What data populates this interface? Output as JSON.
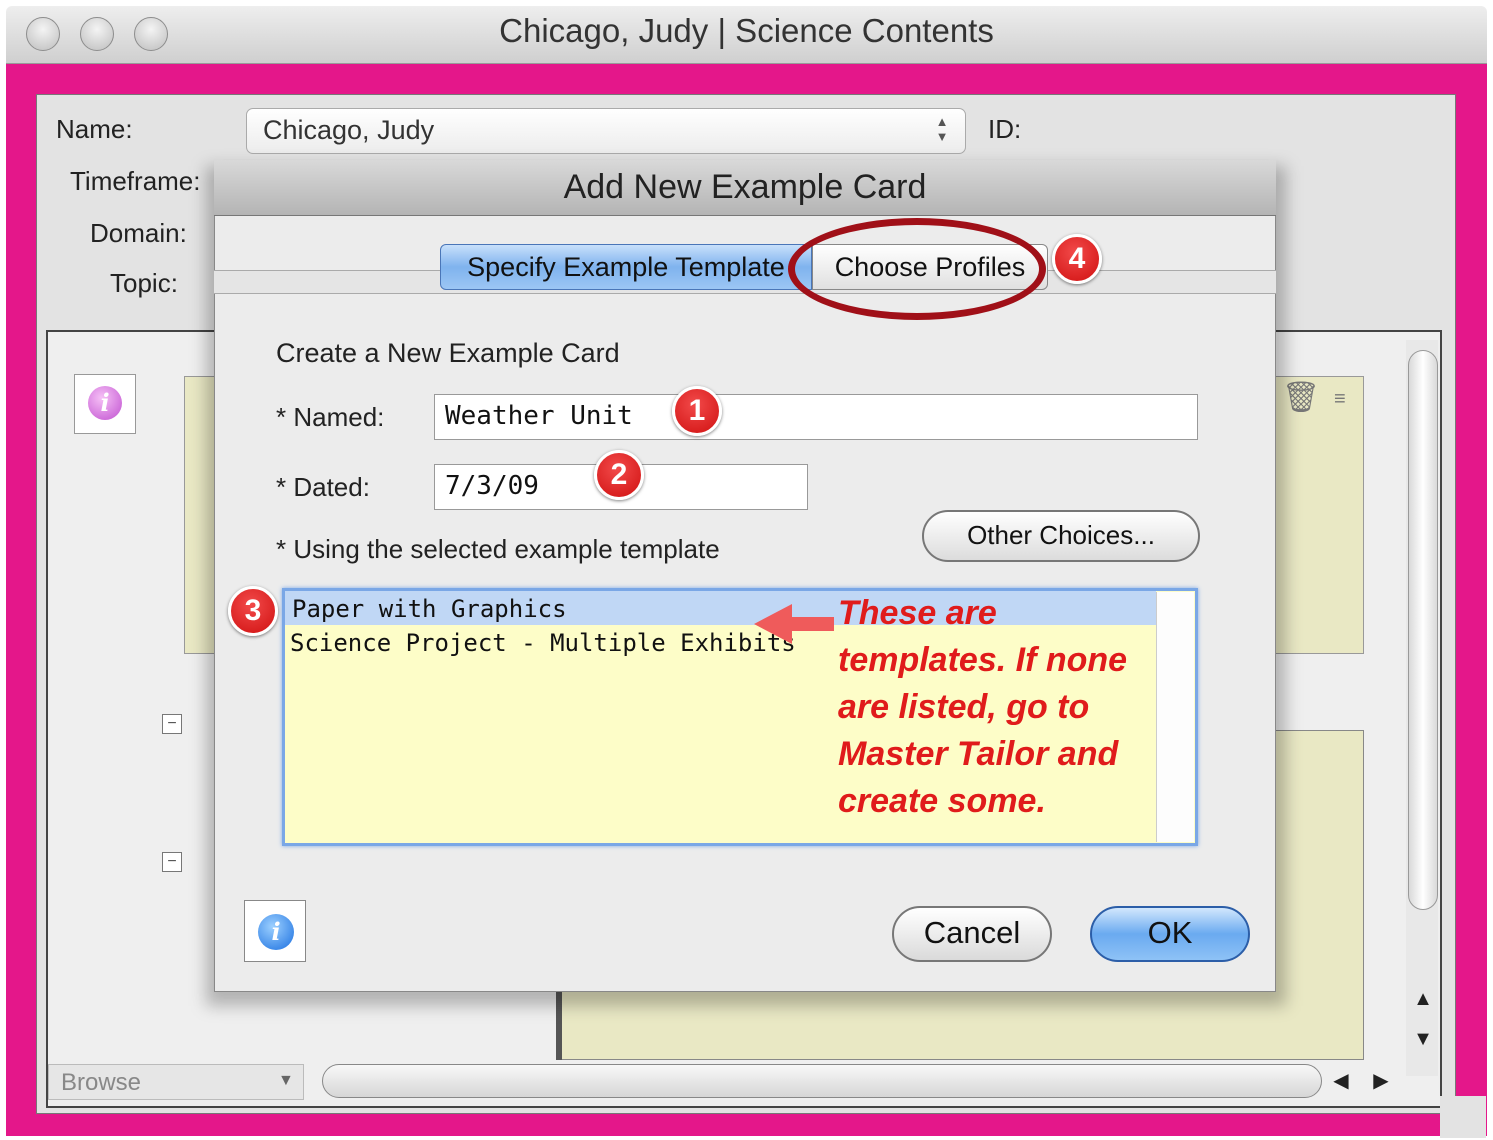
{
  "window": {
    "title": "Chicago, Judy | Science Contents"
  },
  "form": {
    "name_label": "Name:",
    "name_value": "Chicago, Judy",
    "id_label": "ID:",
    "timeframe_label": "Timeframe:",
    "domain_label": "Domain:",
    "topic_label": "Topic:"
  },
  "bottom": {
    "browse_label": "Browse"
  },
  "dialog": {
    "title": "Add New Example Card",
    "tabs": [
      "Specify Example Template",
      "Choose Profiles"
    ],
    "section_heading": "Create a New Example Card",
    "named_label": "* Named:",
    "named_value": "Weather Unit",
    "dated_label": "* Dated:",
    "dated_value": "7/3/09",
    "other_choices": "Other Choices...",
    "using_label": "* Using the selected example template",
    "templates": [
      "Paper with Graphics",
      "Science Project - Multiple Exhibits"
    ],
    "selected_template_index": 0,
    "cancel": "Cancel",
    "ok": "OK"
  },
  "annotations": {
    "badges": [
      "1",
      "2",
      "3",
      "4"
    ],
    "note": "These are templates. If none are listed, go to Master Tailor and create some.",
    "colors": {
      "badge": "#d01010",
      "note": "#e01b1b",
      "frame": "#e4178a",
      "ellipse": "#a01018"
    }
  }
}
